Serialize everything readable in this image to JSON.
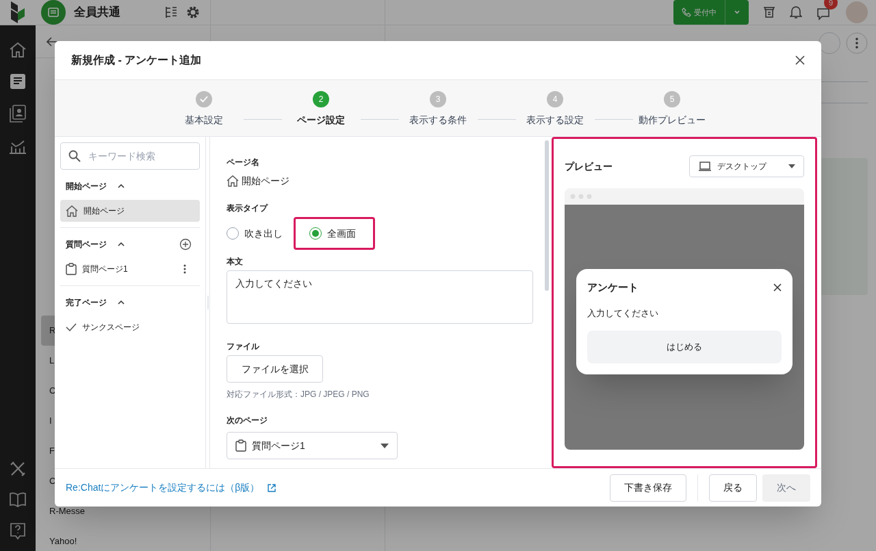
{
  "app": {
    "header": {
      "workspace": "全員共通",
      "status_button": "受付中",
      "notification_badge": "9"
    },
    "background_list": [
      {
        "text": "R",
        "selected": true
      },
      {
        "text": "L",
        "selected": false
      },
      {
        "text": "C",
        "selected": false
      },
      {
        "text": "I",
        "selected": false
      },
      {
        "text": "F",
        "selected": false
      },
      {
        "text": "C",
        "selected": false
      },
      {
        "text": "R-Messe",
        "selected": false
      },
      {
        "text": "Yahoo!",
        "selected": false
      }
    ]
  },
  "modal": {
    "title": "新規作成 - アンケート追加",
    "steps": [
      {
        "label": "基本設定",
        "completed": true,
        "selected": false
      },
      {
        "number": "2",
        "label": "ページ設定",
        "completed": false,
        "selected": true
      },
      {
        "number": "3",
        "label": "表示する条件",
        "completed": false,
        "selected": false
      },
      {
        "number": "4",
        "label": "表示する設定",
        "completed": false,
        "selected": false
      },
      {
        "number": "5",
        "label": "動作プレビュー",
        "completed": false,
        "selected": false
      }
    ],
    "sidebar": {
      "search_placeholder": "キーワード検索",
      "sections": [
        {
          "title": "開始ページ",
          "expanded": true,
          "can_add": false,
          "items": [
            {
              "label": "開始ページ",
              "kind": "start",
              "selected": true
            }
          ]
        },
        {
          "title": "質問ページ",
          "expanded": true,
          "can_add": true,
          "items": [
            {
              "label": "質問ページ1",
              "kind": "question",
              "selected": false
            }
          ]
        },
        {
          "title": "完了ページ",
          "expanded": true,
          "can_add": false,
          "items": [
            {
              "label": "サンクスページ",
              "kind": "complete",
              "selected": false
            }
          ]
        }
      ]
    },
    "form": {
      "page_name_label": "ページ名",
      "page_name": "開始ページ",
      "display_type_label": "表示タイプ",
      "display_types": [
        {
          "label": "吹き出し",
          "selected": false,
          "highlighted": false
        },
        {
          "label": "全画面",
          "selected": true,
          "highlighted": true
        }
      ],
      "body_label": "本文",
      "body_value": "入力してください",
      "file_label": "ファイル",
      "file_button": "ファイルを選択",
      "file_hint": "対応ファイル形式：JPG / JPEG / PNG",
      "next_page_label": "次のページ",
      "next_page": "質問ページ1"
    },
    "preview": {
      "title": "プレビュー",
      "device": "デスクトップ",
      "highlighted": true,
      "popup_title": "アンケート",
      "popup_body": "入力してください",
      "popup_button": "はじめる"
    },
    "footer": {
      "help_link": "Re:Chatにアンケートを設定するには（β版）",
      "buttons": [
        {
          "label": "下書き保存",
          "kind": "secondary",
          "disabled": false
        },
        {
          "label": "戻る",
          "kind": "secondary",
          "disabled": false
        },
        {
          "label": "次へ",
          "kind": "primary",
          "disabled": true
        }
      ]
    }
  }
}
